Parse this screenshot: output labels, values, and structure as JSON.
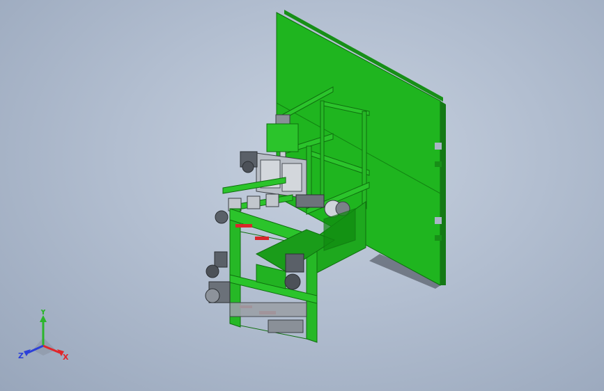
{
  "viewport": {
    "background_top": "#c7d1df",
    "background_bottom": "#98a6bb"
  },
  "model": {
    "frame_color": "#22b322",
    "frame_dark": "#178a17",
    "metal_color": "#9aa1a8",
    "accent_red": "#d9262b"
  },
  "triad": {
    "x_label": "X",
    "y_label": "Y",
    "z_label": "Z",
    "x_color": "#e0262b",
    "y_color": "#2bb52b",
    "z_color": "#2b3fd9"
  }
}
